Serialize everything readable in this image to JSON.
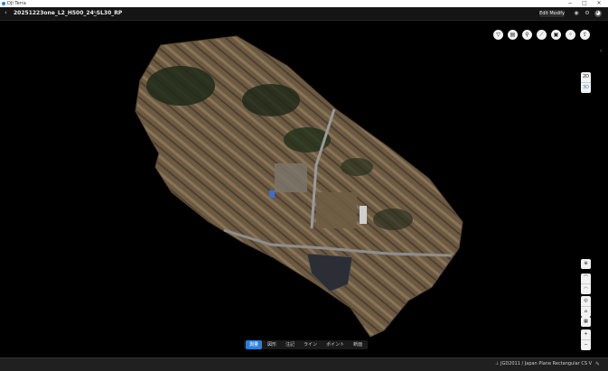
{
  "titlebar": {
    "app_title": "DJI Terra",
    "minimize": "−",
    "maximize": "□",
    "close": "✕"
  },
  "toolbar": {
    "back": "‹",
    "project_name": "20251223one_L2_H500_24_SL30_RP",
    "edit_icon": "✎",
    "edit_mode_label": "Edit Modify",
    "icons": [
      "record-icon",
      "settings-icon",
      "user-icon"
    ]
  },
  "view_tools": {
    "icons": [
      "filter-icon",
      "layer-icon",
      "location-icon",
      "measure-icon",
      "capture-icon",
      "pointcloud-icon",
      "export-icon"
    ]
  },
  "view_mode": {
    "options": [
      "2D",
      "3D"
    ],
    "active": "3D"
  },
  "navigation": {
    "compass": "⊕",
    "zoom_in": "+",
    "zoom_out": "−"
  },
  "bottom_tabs": {
    "active_index": 0,
    "items": [
      "測量",
      "図形",
      "注記",
      "ライン",
      "ポイント",
      "断面"
    ]
  },
  "statusbar": {
    "crs_text": "⊥ JGD2011 / Japan Plane Rectangular CS V"
  },
  "colors": {
    "accent": "#2a7fd6",
    "background": "#000000",
    "toolbar": "#151515"
  }
}
